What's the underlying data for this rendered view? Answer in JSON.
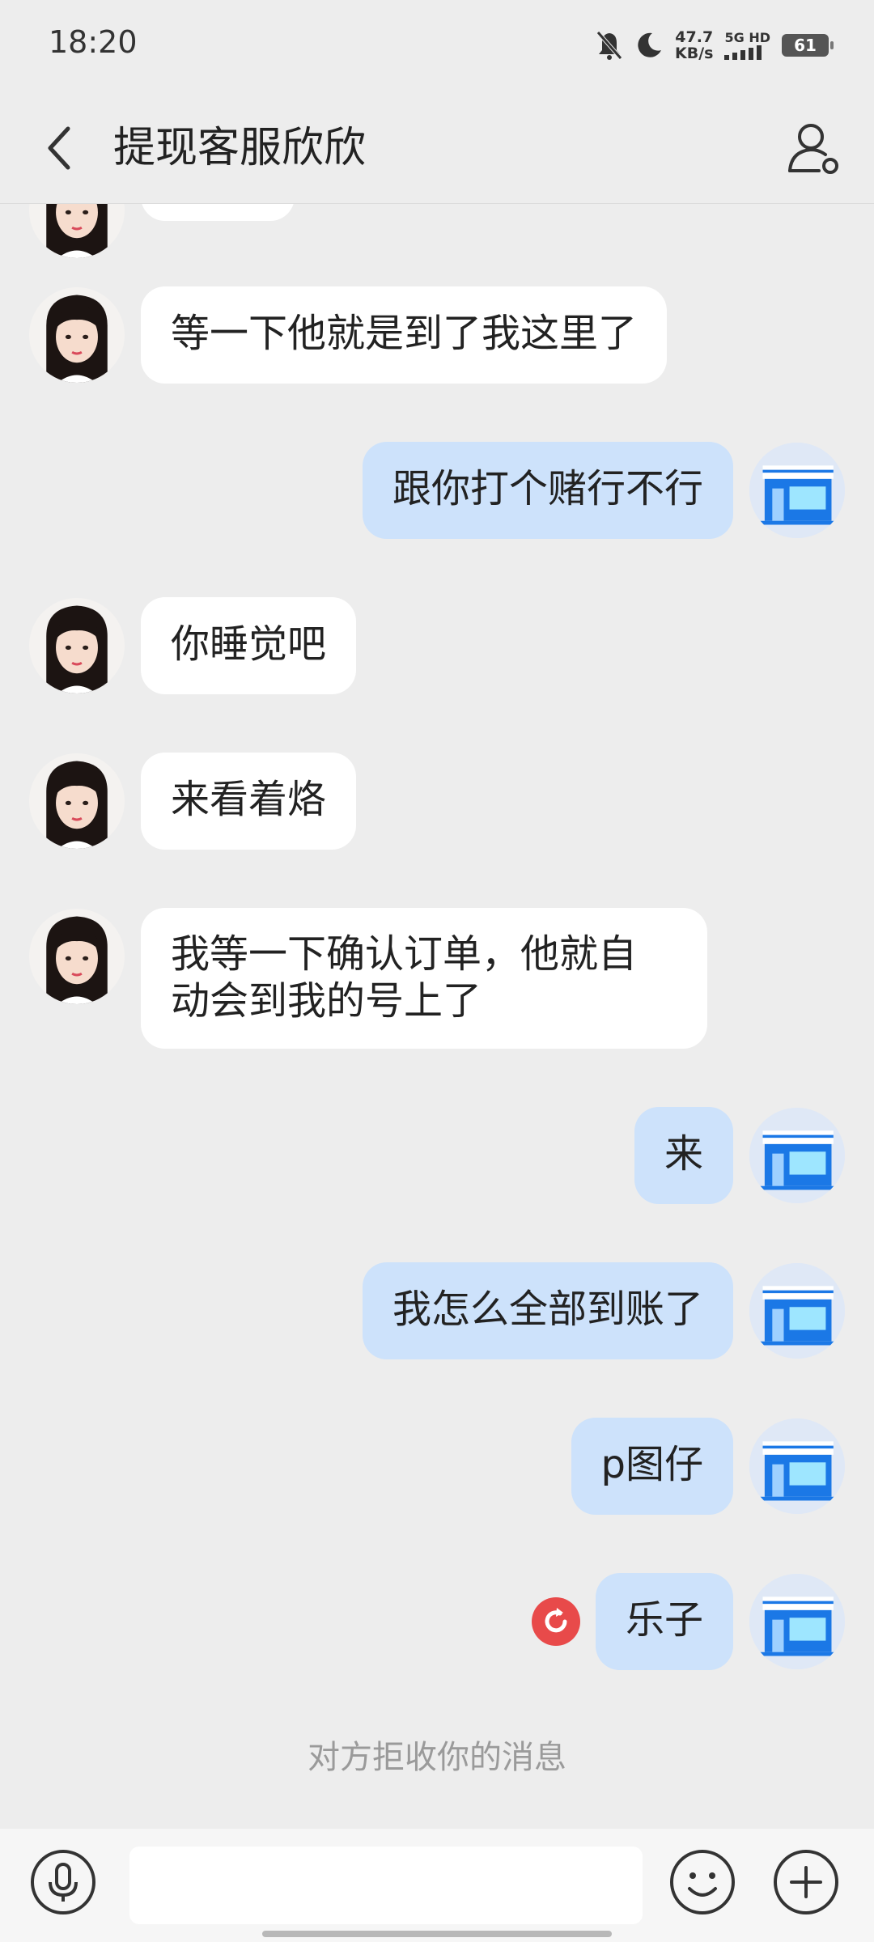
{
  "status_bar": {
    "time": "18:20",
    "net_speed_value": "47.7",
    "net_speed_unit": "KB/s",
    "network_type": "5G HD",
    "battery": "61",
    "icons": [
      "mute-icon",
      "moon-icon",
      "signal-icon",
      "battery-icon"
    ]
  },
  "header": {
    "title": "提现客服欣欣",
    "back_icon": "chevron-left-icon",
    "profile_icon": "person-settings-icon"
  },
  "messages": [
    {
      "side": "left",
      "text": "等一下他就是到了我这里了"
    },
    {
      "side": "right",
      "text": "跟你打个赌行不行"
    },
    {
      "side": "left",
      "text": "你睡觉吧"
    },
    {
      "side": "left",
      "text": "来看着烙"
    },
    {
      "side": "left",
      "line1": "我等一下确认订单，他就自",
      "line2": "动会到我的号上了"
    },
    {
      "side": "right",
      "text": "来"
    },
    {
      "side": "right",
      "text": "我怎么全部到账了"
    },
    {
      "side": "right",
      "text": "p图仔"
    },
    {
      "side": "right",
      "text": "乐子",
      "status": "resend-icon"
    }
  ],
  "notice": "对方拒收你的消息",
  "input_bar": {
    "placeholder": "",
    "icons": [
      "microphone-icon",
      "emoji-icon",
      "plus-icon"
    ]
  },
  "colors": {
    "background": "#ededed",
    "bubble_left": "#ffffff",
    "bubble_right": "#cde2fb",
    "resend_red": "#e84a4a",
    "store_blue": "#1b78e6"
  }
}
